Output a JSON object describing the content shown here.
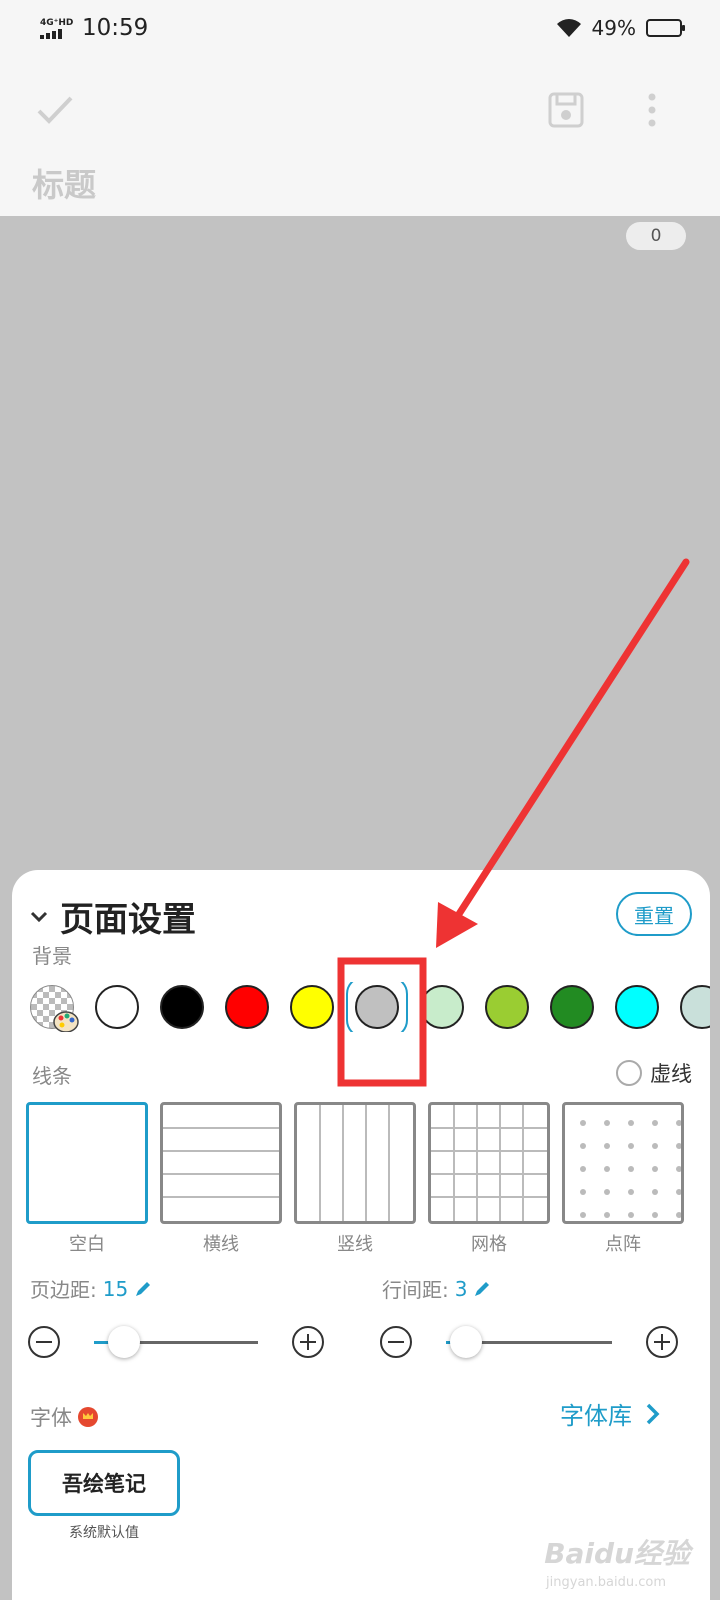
{
  "status_bar": {
    "network": "4G⁺HD",
    "time": "10:59",
    "battery_percent": "49%",
    "battery_level": 0.49
  },
  "toolbar": {
    "title_placeholder": "标题",
    "confirm_icon": "checkmark-icon",
    "save_icon": "save-icon",
    "more_icon": "more-vertical-icon"
  },
  "editor": {
    "char_count": "0",
    "background_color": "#c2c2c2"
  },
  "page_settings": {
    "title": "页面设置",
    "reset_label": "重置",
    "background_label": "背景",
    "background_colors": [
      "transparent",
      "#ffffff",
      "#000000",
      "#ff0000",
      "#ffff00",
      "#c0c0c0",
      "#c8eccb",
      "#9acd32",
      "#228b22",
      "#00ffff",
      "#c9e0da"
    ],
    "selected_background_index": 5,
    "lines_label": "线条",
    "dashed_label": "虚线",
    "line_styles": [
      {
        "label": "空白",
        "selected": true
      },
      {
        "label": "横线",
        "selected": false
      },
      {
        "label": "竖线",
        "selected": false
      },
      {
        "label": "网格",
        "selected": false
      },
      {
        "label": "点阵",
        "selected": false
      }
    ],
    "margin_label": "页边距:",
    "margin_value": "15",
    "line_spacing_label": "行间距:",
    "line_spacing_value": "3",
    "font_label": "字体",
    "font_library_label": "字体库",
    "current_font": "吾绘笔记",
    "current_font_note": "系统默认值"
  },
  "watermark": {
    "text": "Baidu经验",
    "url": "jingyan.baidu.com"
  },
  "colors": {
    "accent": "#1f9cc9",
    "annotation_red": "#ee3333"
  }
}
